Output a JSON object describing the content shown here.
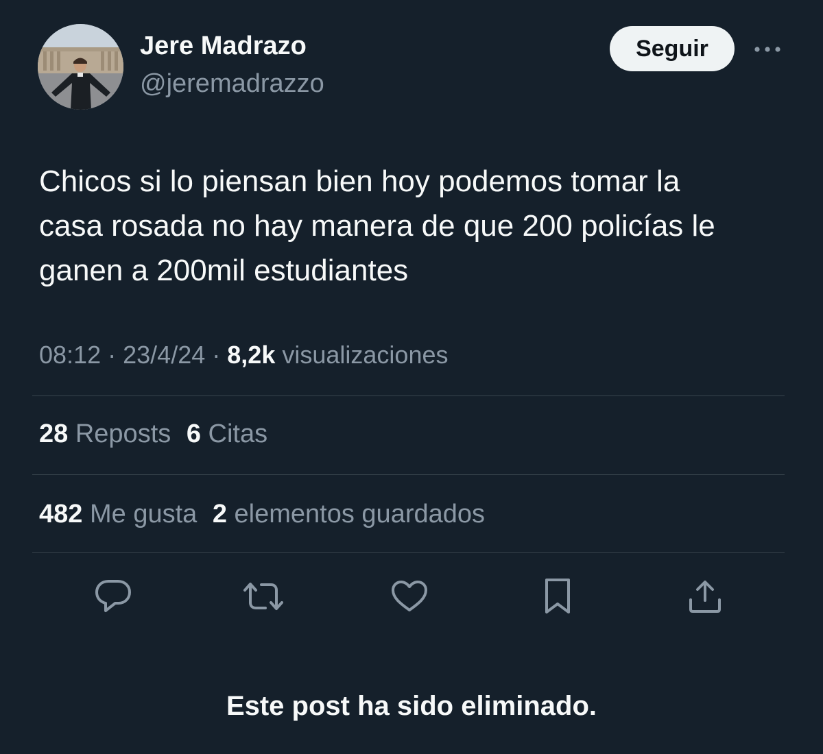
{
  "author": {
    "name": "Jere Madrazo",
    "handle": "@jeremadrazzo",
    "avatar_icon": "profile-photo"
  },
  "header": {
    "follow_label": "Seguir",
    "more_icon": "more-horizontal-icon"
  },
  "post": {
    "text_lines": [
      "Chicos si lo piensan bien hoy podemos tomar la",
      "casa rosada no hay manera de que 200 policías le",
      "ganen a 200mil estudiantes"
    ]
  },
  "meta": {
    "time": "08:12",
    "separator": "·",
    "date": "23/4/24",
    "views_count": "8,2k",
    "views_label": "visualizaciones"
  },
  "stats": {
    "reposts_count": "28",
    "reposts_label": "Reposts",
    "quotes_count": "6",
    "quotes_label": "Citas",
    "likes_count": "482",
    "likes_label": "Me gusta",
    "bookmarks_count": "2",
    "bookmarks_label": "elementos guardados"
  },
  "actions": [
    "reply-icon",
    "repost-icon",
    "like-icon",
    "bookmark-icon",
    "share-icon"
  ],
  "colors": {
    "background": "#15202b",
    "text": "#f7f9f9",
    "muted": "#8b98a5",
    "divider": "#38444d",
    "follow_bg": "#eff3f4"
  },
  "notice": "Este post ha sido eliminado."
}
